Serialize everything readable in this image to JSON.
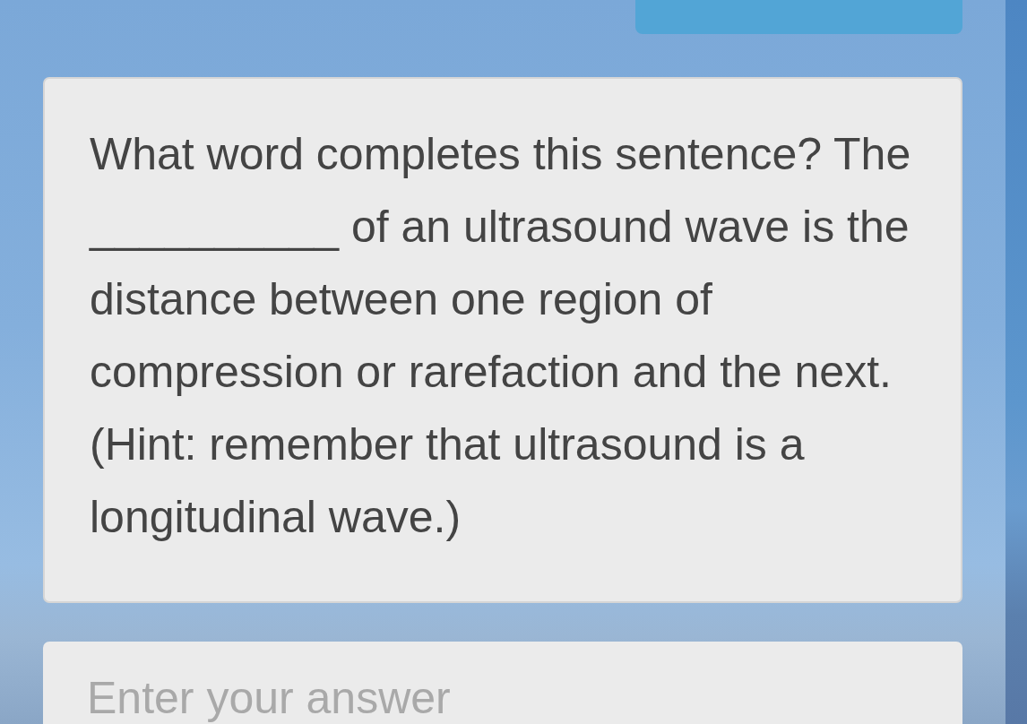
{
  "question": {
    "text": "What word completes this sentence? The __________ of an ultrasound wave is the distance between one region of compression or rarefaction and the next. (Hint: remember that ultrasound is a longitudinal wave.)"
  },
  "answer": {
    "placeholder": "Enter your answer"
  }
}
